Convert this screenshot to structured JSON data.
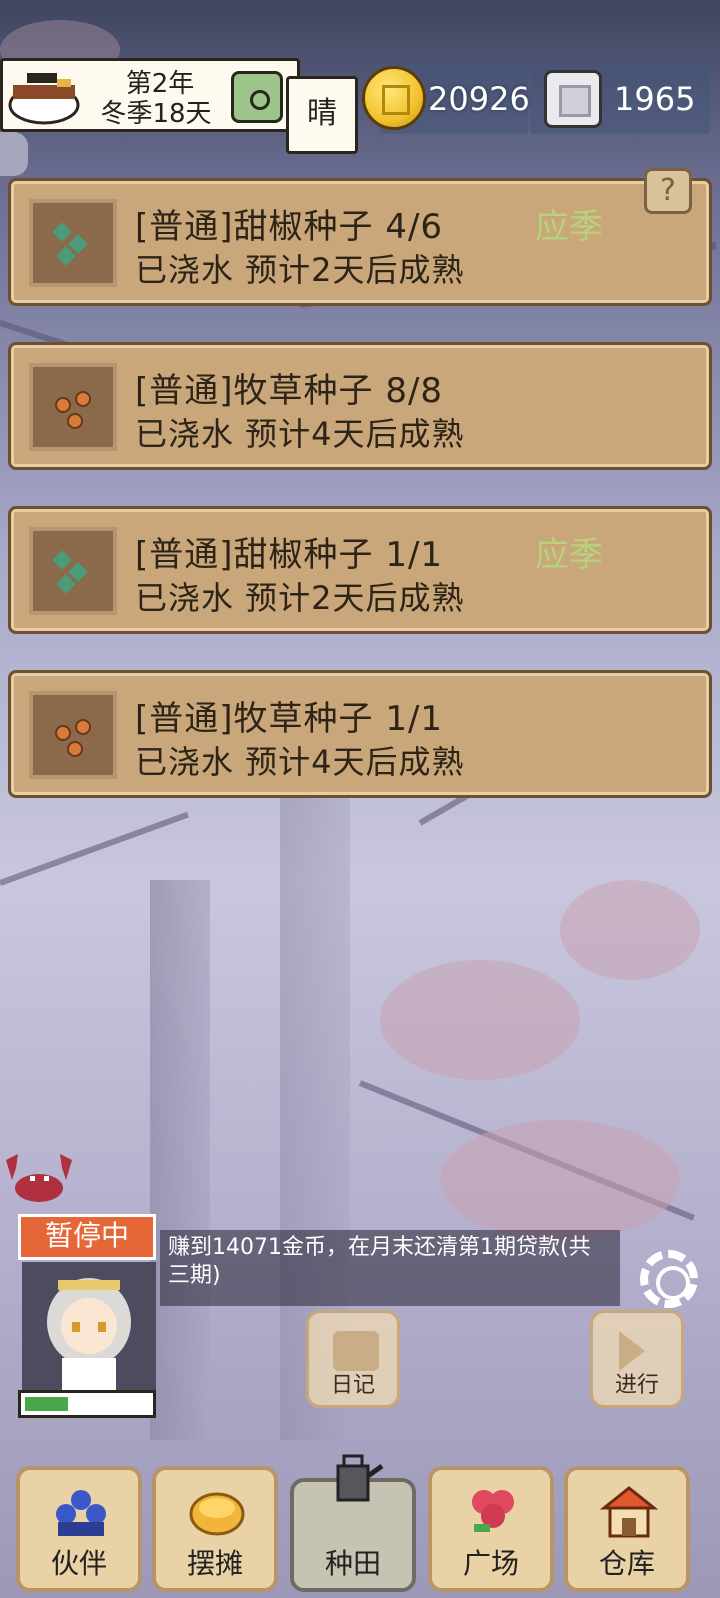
{
  "header": {
    "year": "第2年",
    "season_day": "冬季18天",
    "weather": "晴",
    "gold": "20926",
    "silver": "1965"
  },
  "crops": [
    {
      "title": "[普通]甜椒种子 4/6",
      "status": "已浇水 预计2天后成熟",
      "tag": "应季",
      "icon": "pepper-seed-icon"
    },
    {
      "title": "[普通]牧草种子 8/8",
      "status": "已浇水 预计4天后成熟",
      "tag": "",
      "icon": "grass-seed-icon"
    },
    {
      "title": "[普通]甜椒种子 1/1",
      "status": "已浇水 预计2天后成熟",
      "tag": "应季",
      "icon": "pepper-seed-icon"
    },
    {
      "title": "[普通]牧草种子 1/1",
      "status": "已浇水 预计4天后成熟",
      "tag": "",
      "icon": "grass-seed-icon"
    }
  ],
  "help_label": "?",
  "character": {
    "state": "暂停中",
    "energy_fraction": 0.35,
    "message": "赚到14071金币，在月末还清第1期贷款(共三期)"
  },
  "actions": {
    "diary": "日记",
    "proceed": "进行"
  },
  "nav": [
    {
      "label": "伙伴",
      "icon": "companions-icon"
    },
    {
      "label": "摆摊",
      "icon": "stall-icon"
    },
    {
      "label": "种田",
      "icon": "watering-can-icon",
      "active": true
    },
    {
      "label": "广场",
      "icon": "flower-icon"
    },
    {
      "label": "仓库",
      "icon": "warehouse-icon"
    }
  ],
  "colors": {
    "card": "#c9a77a",
    "tag_green": "#b6d27b",
    "paused_orange": "#e56637"
  }
}
